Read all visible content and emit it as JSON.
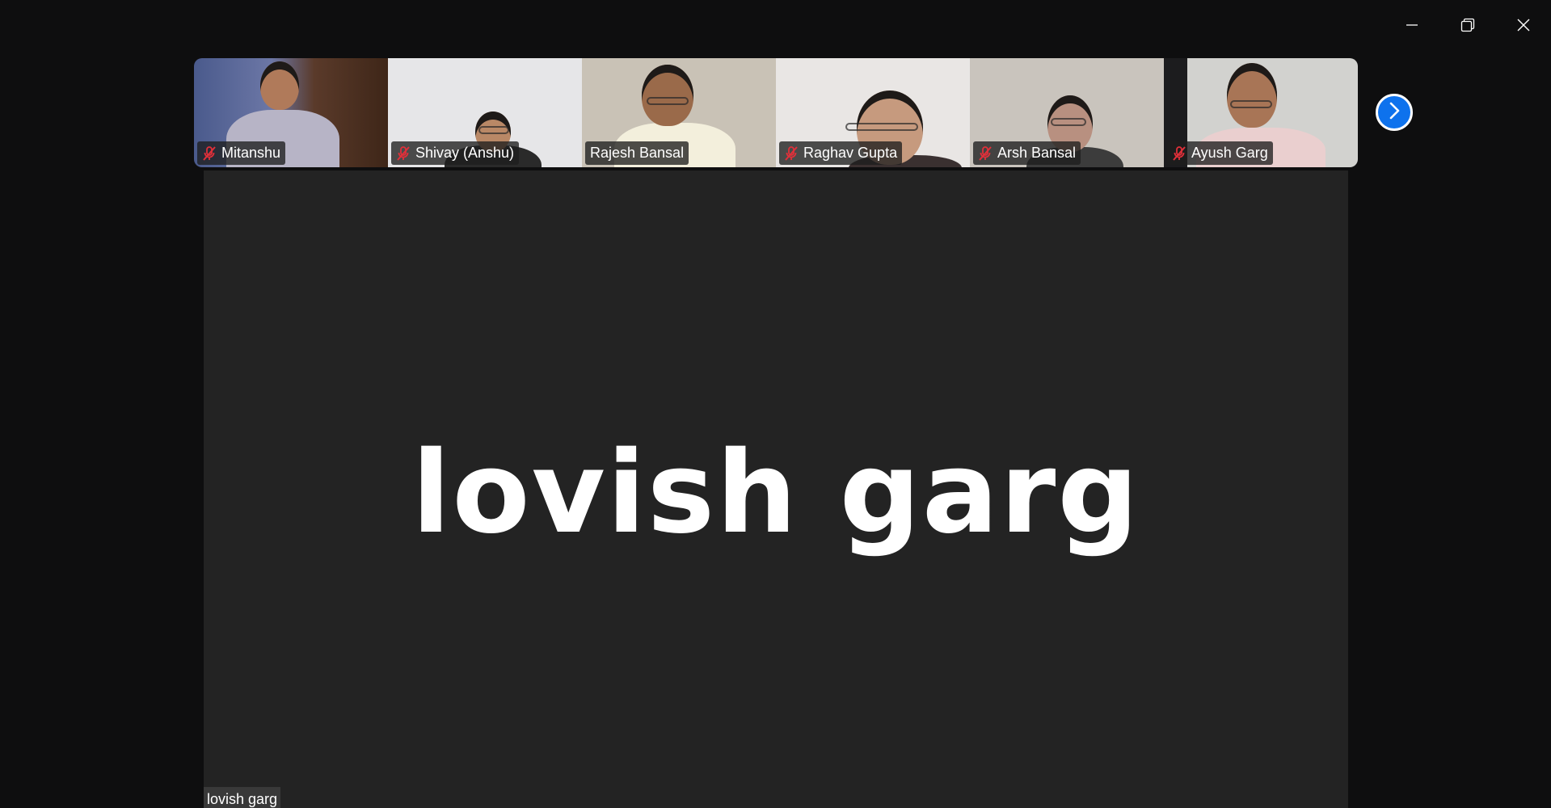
{
  "window": {
    "controls": {
      "minimize": "minimize-icon",
      "restore": "restore-icon",
      "close": "close-icon"
    }
  },
  "participants": [
    {
      "name": "Mitanshu",
      "muted": true,
      "bg": "#5a5f78",
      "skin": "#b07a5a",
      "shirt": "#b7b4c6"
    },
    {
      "name": "Shivay (Anshu)",
      "muted": true,
      "bg": "#e6e6e8",
      "skin": "#b98866",
      "shirt": "#2a2a2a"
    },
    {
      "name": "Rajesh Bansal",
      "muted": false,
      "bg": "#c9c2b6",
      "skin": "#9a6a4a",
      "shirt": "#f3efdc"
    },
    {
      "name": "Raghav Gupta",
      "muted": true,
      "bg": "#e9e6e4",
      "skin": "#c69a7e",
      "shirt": "#3a3030"
    },
    {
      "name": "Arsh Bansal",
      "muted": true,
      "bg": "#c9c4bd",
      "skin": "#b89080",
      "shirt": "#3c3c3c"
    },
    {
      "name": "Ayush Garg",
      "muted": true,
      "bg": "#d2d2cf",
      "skin": "#a87556",
      "shirt": "#eacfcf"
    }
  ],
  "filmstrip": {
    "next_icon": "chevron-right-icon"
  },
  "stage": {
    "display_name": "lovish garg",
    "label": "lovish garg"
  },
  "colors": {
    "accent": "#0e72ed",
    "mute": "#e0303a",
    "stage_bg": "#232323",
    "window_bg": "#0e0e0f"
  }
}
